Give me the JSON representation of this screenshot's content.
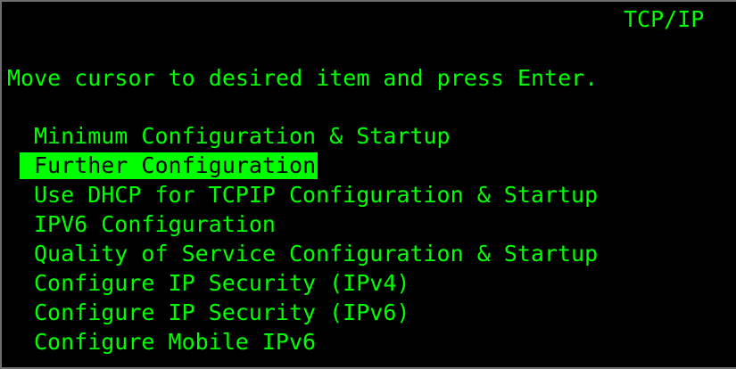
{
  "screen": {
    "title": "TCP/IP",
    "instruction": "Move cursor to desired item and press Enter."
  },
  "menu": {
    "items": [
      {
        "label": "Minimum Configuration & Startup",
        "selected": false
      },
      {
        "label": "Further Configuration",
        "selected": true
      },
      {
        "label": "Use DHCP for TCPIP Configuration & Startup",
        "selected": false
      },
      {
        "label": "IPV6 Configuration",
        "selected": false
      },
      {
        "label": "Quality of Service Configuration & Startup",
        "selected": false
      },
      {
        "label": "Configure IP Security (IPv4)",
        "selected": false
      },
      {
        "label": "Configure IP Security (IPv6)",
        "selected": false
      },
      {
        "label": "Configure Mobile IPv6",
        "selected": false
      }
    ]
  },
  "colors": {
    "background": "#000000",
    "text": "#00ff00",
    "highlight_bg": "#00ff00",
    "highlight_text": "#000000"
  }
}
